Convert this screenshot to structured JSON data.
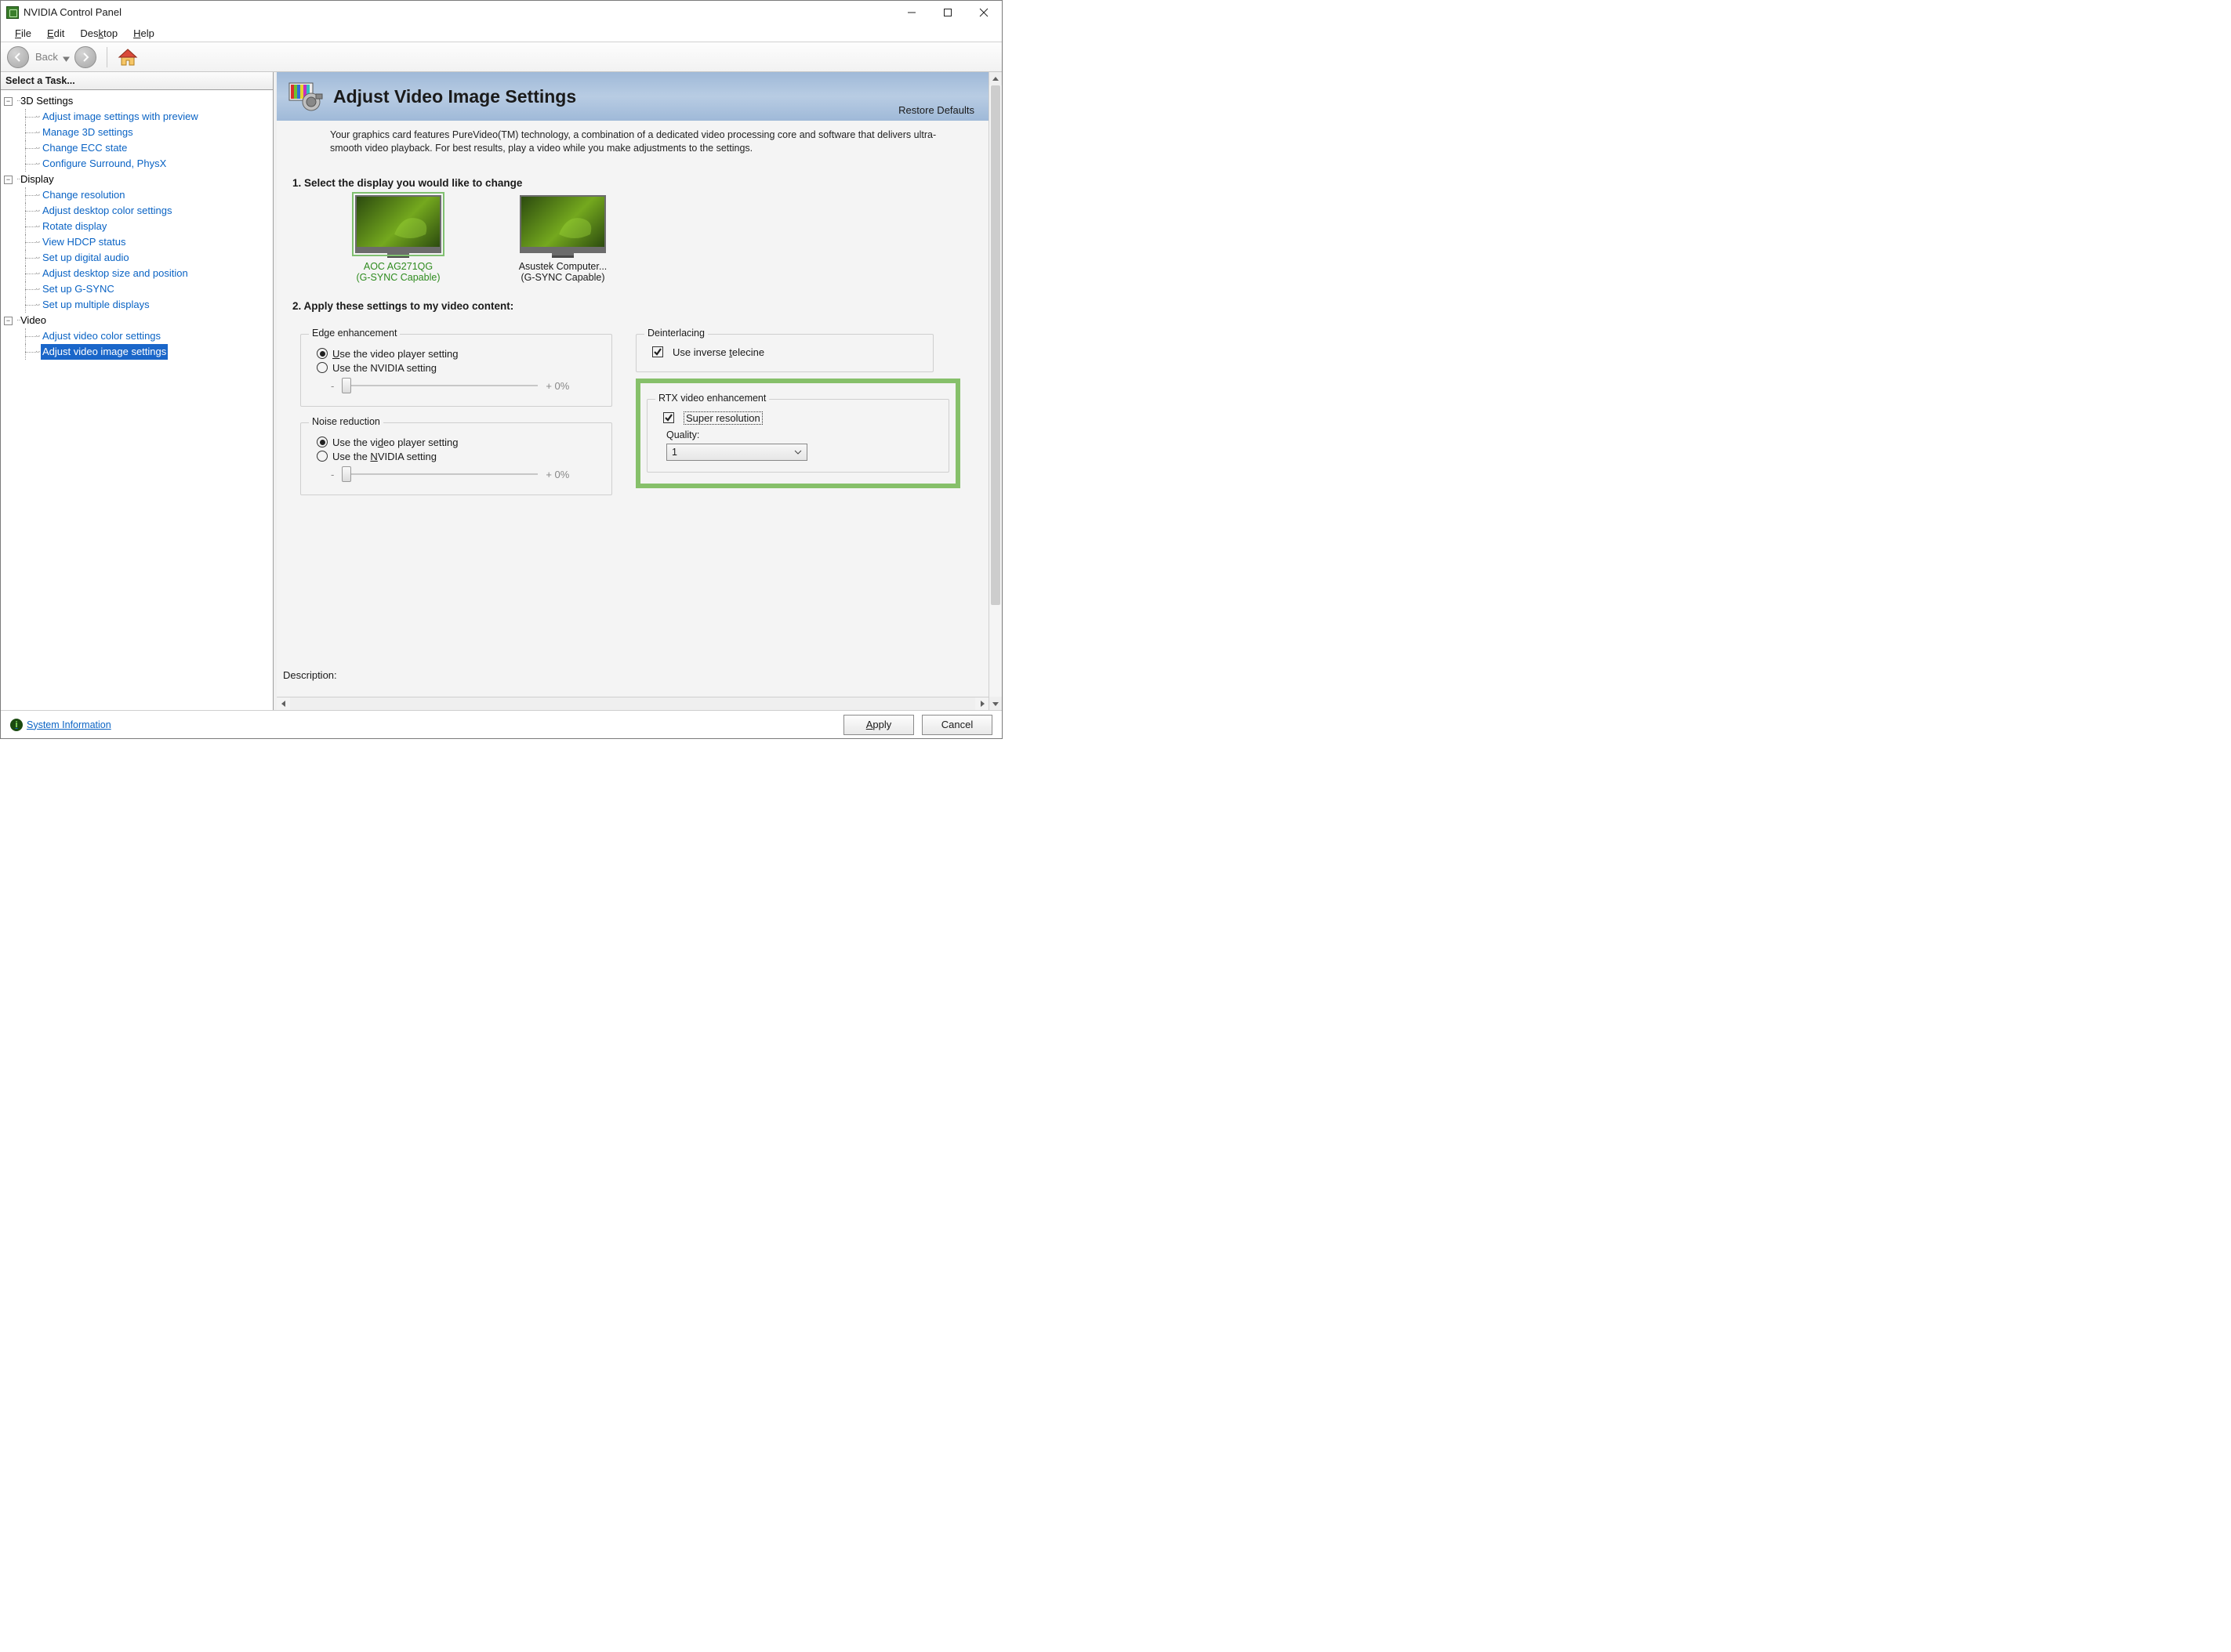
{
  "window": {
    "title": "NVIDIA Control Panel"
  },
  "menu": {
    "file": "File",
    "edit": "Edit",
    "desktop": "Desktop",
    "help": "Help"
  },
  "toolbar": {
    "back": "Back"
  },
  "sidebar": {
    "header": "Select a Task...",
    "groups": [
      {
        "label": "3D Settings",
        "items": [
          "Adjust image settings with preview",
          "Manage 3D settings",
          "Change ECC state",
          "Configure Surround, PhysX"
        ]
      },
      {
        "label": "Display",
        "items": [
          "Change resolution",
          "Adjust desktop color settings",
          "Rotate display",
          "View HDCP status",
          "Set up digital audio",
          "Adjust desktop size and position",
          "Set up G-SYNC",
          "Set up multiple displays"
        ]
      },
      {
        "label": "Video",
        "items": [
          "Adjust video color settings",
          "Adjust video image settings"
        ]
      }
    ],
    "selected": "Adjust video image settings"
  },
  "page": {
    "title": "Adjust Video Image Settings",
    "restore": "Restore Defaults",
    "intro": "Your graphics card features PureVideo(TM) technology, a combination of a dedicated video processing core and software that delivers ultra-smooth video playback. For best results, play a video while you make adjustments to the settings.",
    "step1": "1. Select the display you would like to change",
    "displays": [
      {
        "name": "AOC AG271QG",
        "sub": "(G-SYNC Capable)",
        "selected": true
      },
      {
        "name": "Asustek Computer...",
        "sub": "(G-SYNC Capable)",
        "selected": false
      }
    ],
    "step2": "2. Apply these settings to my video content:",
    "edge": {
      "legend": "Edge enhancement",
      "opt_player": "Use the video player setting",
      "opt_nvidia": "Use the NVIDIA setting",
      "value": "+ 0%"
    },
    "noise": {
      "legend": "Noise reduction",
      "opt_player": "Use the video player setting",
      "opt_nvidia": "Use the NVIDIA setting",
      "value": "+ 0%"
    },
    "deint": {
      "legend": "Deinterlacing",
      "opt": "Use inverse telecine"
    },
    "rtx": {
      "legend": "RTX video enhancement",
      "super": "Super resolution",
      "quality_label": "Quality:",
      "quality_value": "1"
    },
    "description_label": "Description:"
  },
  "footer": {
    "sysinfo": "System Information",
    "apply": "Apply",
    "cancel": "Cancel"
  }
}
